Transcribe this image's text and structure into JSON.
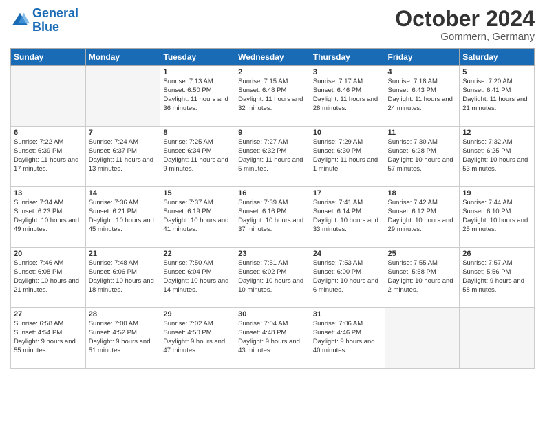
{
  "header": {
    "logo_line1": "General",
    "logo_line2": "Blue",
    "month": "October 2024",
    "location": "Gommern, Germany"
  },
  "weekdays": [
    "Sunday",
    "Monday",
    "Tuesday",
    "Wednesday",
    "Thursday",
    "Friday",
    "Saturday"
  ],
  "weeks": [
    [
      {
        "day": "",
        "info": ""
      },
      {
        "day": "",
        "info": ""
      },
      {
        "day": "1",
        "info": "Sunrise: 7:13 AM\nSunset: 6:50 PM\nDaylight: 11 hours and 36 minutes."
      },
      {
        "day": "2",
        "info": "Sunrise: 7:15 AM\nSunset: 6:48 PM\nDaylight: 11 hours and 32 minutes."
      },
      {
        "day": "3",
        "info": "Sunrise: 7:17 AM\nSunset: 6:46 PM\nDaylight: 11 hours and 28 minutes."
      },
      {
        "day": "4",
        "info": "Sunrise: 7:18 AM\nSunset: 6:43 PM\nDaylight: 11 hours and 24 minutes."
      },
      {
        "day": "5",
        "info": "Sunrise: 7:20 AM\nSunset: 6:41 PM\nDaylight: 11 hours and 21 minutes."
      }
    ],
    [
      {
        "day": "6",
        "info": "Sunrise: 7:22 AM\nSunset: 6:39 PM\nDaylight: 11 hours and 17 minutes."
      },
      {
        "day": "7",
        "info": "Sunrise: 7:24 AM\nSunset: 6:37 PM\nDaylight: 11 hours and 13 minutes."
      },
      {
        "day": "8",
        "info": "Sunrise: 7:25 AM\nSunset: 6:34 PM\nDaylight: 11 hours and 9 minutes."
      },
      {
        "day": "9",
        "info": "Sunrise: 7:27 AM\nSunset: 6:32 PM\nDaylight: 11 hours and 5 minutes."
      },
      {
        "day": "10",
        "info": "Sunrise: 7:29 AM\nSunset: 6:30 PM\nDaylight: 11 hours and 1 minute."
      },
      {
        "day": "11",
        "info": "Sunrise: 7:30 AM\nSunset: 6:28 PM\nDaylight: 10 hours and 57 minutes."
      },
      {
        "day": "12",
        "info": "Sunrise: 7:32 AM\nSunset: 6:25 PM\nDaylight: 10 hours and 53 minutes."
      }
    ],
    [
      {
        "day": "13",
        "info": "Sunrise: 7:34 AM\nSunset: 6:23 PM\nDaylight: 10 hours and 49 minutes."
      },
      {
        "day": "14",
        "info": "Sunrise: 7:36 AM\nSunset: 6:21 PM\nDaylight: 10 hours and 45 minutes."
      },
      {
        "day": "15",
        "info": "Sunrise: 7:37 AM\nSunset: 6:19 PM\nDaylight: 10 hours and 41 minutes."
      },
      {
        "day": "16",
        "info": "Sunrise: 7:39 AM\nSunset: 6:16 PM\nDaylight: 10 hours and 37 minutes."
      },
      {
        "day": "17",
        "info": "Sunrise: 7:41 AM\nSunset: 6:14 PM\nDaylight: 10 hours and 33 minutes."
      },
      {
        "day": "18",
        "info": "Sunrise: 7:42 AM\nSunset: 6:12 PM\nDaylight: 10 hours and 29 minutes."
      },
      {
        "day": "19",
        "info": "Sunrise: 7:44 AM\nSunset: 6:10 PM\nDaylight: 10 hours and 25 minutes."
      }
    ],
    [
      {
        "day": "20",
        "info": "Sunrise: 7:46 AM\nSunset: 6:08 PM\nDaylight: 10 hours and 21 minutes."
      },
      {
        "day": "21",
        "info": "Sunrise: 7:48 AM\nSunset: 6:06 PM\nDaylight: 10 hours and 18 minutes."
      },
      {
        "day": "22",
        "info": "Sunrise: 7:50 AM\nSunset: 6:04 PM\nDaylight: 10 hours and 14 minutes."
      },
      {
        "day": "23",
        "info": "Sunrise: 7:51 AM\nSunset: 6:02 PM\nDaylight: 10 hours and 10 minutes."
      },
      {
        "day": "24",
        "info": "Sunrise: 7:53 AM\nSunset: 6:00 PM\nDaylight: 10 hours and 6 minutes."
      },
      {
        "day": "25",
        "info": "Sunrise: 7:55 AM\nSunset: 5:58 PM\nDaylight: 10 hours and 2 minutes."
      },
      {
        "day": "26",
        "info": "Sunrise: 7:57 AM\nSunset: 5:56 PM\nDaylight: 9 hours and 58 minutes."
      }
    ],
    [
      {
        "day": "27",
        "info": "Sunrise: 6:58 AM\nSunset: 4:54 PM\nDaylight: 9 hours and 55 minutes."
      },
      {
        "day": "28",
        "info": "Sunrise: 7:00 AM\nSunset: 4:52 PM\nDaylight: 9 hours and 51 minutes."
      },
      {
        "day": "29",
        "info": "Sunrise: 7:02 AM\nSunset: 4:50 PM\nDaylight: 9 hours and 47 minutes."
      },
      {
        "day": "30",
        "info": "Sunrise: 7:04 AM\nSunset: 4:48 PM\nDaylight: 9 hours and 43 minutes."
      },
      {
        "day": "31",
        "info": "Sunrise: 7:06 AM\nSunset: 4:46 PM\nDaylight: 9 hours and 40 minutes."
      },
      {
        "day": "",
        "info": ""
      },
      {
        "day": "",
        "info": ""
      }
    ]
  ]
}
